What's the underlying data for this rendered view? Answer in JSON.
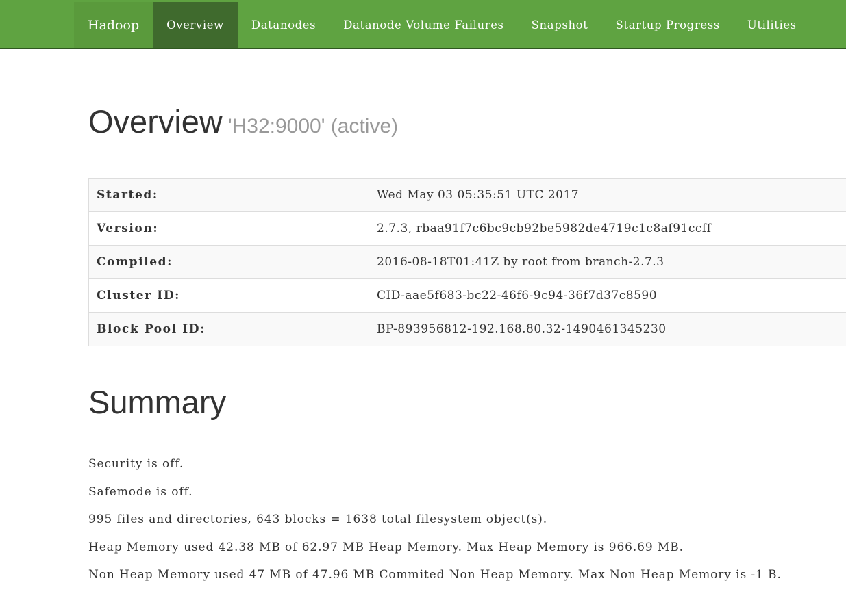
{
  "nav": {
    "brand": "Hadoop",
    "items": [
      "Overview",
      "Datanodes",
      "Datanode Volume Failures",
      "Snapshot",
      "Startup Progress",
      "Utilities"
    ],
    "active_index": 0,
    "colors": {
      "bar": "#5fa341",
      "active": "#3f6a2d"
    }
  },
  "overview": {
    "title": "Overview",
    "subtitle": "'H32:9000' (active)"
  },
  "info_table": [
    {
      "label": "Started:",
      "value": "Wed May 03 05:35:51 UTC 2017"
    },
    {
      "label": "Version:",
      "value": "2.7.3, rbaa91f7c6bc9cb92be5982de4719c1c8af91ccff"
    },
    {
      "label": "Compiled:",
      "value": "2016-08-18T01:41Z by root from branch-2.7.3"
    },
    {
      "label": "Cluster ID:",
      "value": "CID-aae5f683-bc22-46f6-9c94-36f7d37c8590"
    },
    {
      "label": "Block Pool ID:",
      "value": "BP-893956812-192.168.80.32-1490461345230"
    }
  ],
  "summary": {
    "title": "Summary",
    "lines": [
      "Security is off.",
      "Safemode is off.",
      "995 files and directories, 643 blocks = 1638 total filesystem object(s).",
      "Heap Memory used 42.38 MB of 62.97 MB Heap Memory. Max Heap Memory is 966.69 MB.",
      "Non Heap Memory used 47 MB of 47.96 MB Commited Non Heap Memory. Max Non Heap Memory is -1 B."
    ]
  }
}
